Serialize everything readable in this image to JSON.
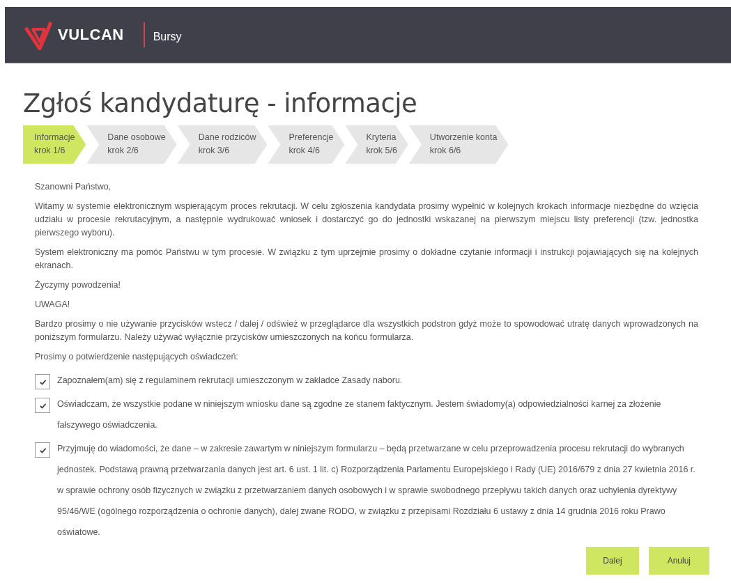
{
  "header": {
    "brand": "VULCAN",
    "app": "Bursy"
  },
  "title": "Zgłoś kandydaturę - informacje",
  "steps": [
    {
      "label": "Informacje",
      "step": "krok 1/6",
      "selected": true
    },
    {
      "label": "Dane osobowe",
      "step": "krok 2/6",
      "selected": false
    },
    {
      "label": "Dane rodziców",
      "step": "krok 3/6",
      "selected": false
    },
    {
      "label": "Preferencje",
      "step": "krok 4/6",
      "selected": false
    },
    {
      "label": "Kryteria",
      "step": "krok 5/6",
      "selected": false
    },
    {
      "label": "Utworzenie konta",
      "step": "krok 6/6",
      "selected": false
    }
  ],
  "paragraphs": [
    "Szanowni Państwo,",
    "Witamy w systemie elektronicznym wspierającym proces rekrutacji. W celu zgłoszenia kandydata prosimy wypełnić w kolejnych krokach informacje niezbędne do wzięcia udziału w procesie rekrutacyjnym, a następnie wydrukować wniosek i dostarczyć go do jednostki wskazanej na pierwszym miejscu listy preferencji (tzw. jednostka pierwszego wyboru).",
    "System elektroniczny ma pomóc Państwu w tym procesie. W związku z tym uprzejmie prosimy o dokładne czytanie informacji i instrukcji pojawiających się na kolejnych ekranach.",
    "Życzymy powodzenia!",
    "UWAGA!",
    "Bardzo prosimy o nie używanie przycisków wstecz / dalej / odśwież w przeglądarce dla wszystkich podstron gdyż może to spowodować utratę danych wprowadzonych na poniższym formularzu. Należy używać wyłącznie przycisków umieszczonych na końcu formularza.",
    "Prosimy o potwierdzenie następujących oświadczeń:"
  ],
  "statements": [
    {
      "text": "Zapoznałem(am) się z regulaminem rekrutacji umieszczonym w zakładce Zasady naboru.",
      "checked": true
    },
    {
      "text": "Oświadczam, że wszystkie podane w niniejszym wniosku dane są zgodne ze stanem faktycznym. Jestem świadomy(a) odpowiedzialności karnej za złożenie fałszywego oświadczenia.",
      "checked": true
    },
    {
      "text": "Przyjmuję do wiadomości, że dane – w zakresie zawartym w niniejszym formularzu – będą przetwarzane w celu przeprowadzenia procesu rekrutacji do wybranych jednostek. Podstawą prawną przetwarzania danych jest art. 6 ust. 1 lit. c) Rozporządzenia Parlamentu Europejskiego i Rady (UE) 2016/679 z dnia 27 kwietnia 2016 r. w sprawie ochrony osób fizycznych w związku z przetwarzaniem danych osobowych i w sprawie swobodnego przepływu takich danych oraz uchylenia dyrektywy 95/46/WE (ogólnego rozporządzenia o ochronie danych), dalej zwane RODO, w związku z przepisami Rozdziału 6 ustawy z dnia 14 grudnia 2016 roku Prawo oświatowe.",
      "checked": true
    }
  ],
  "buttons": [
    "Dalej",
    "Anuluj"
  ]
}
